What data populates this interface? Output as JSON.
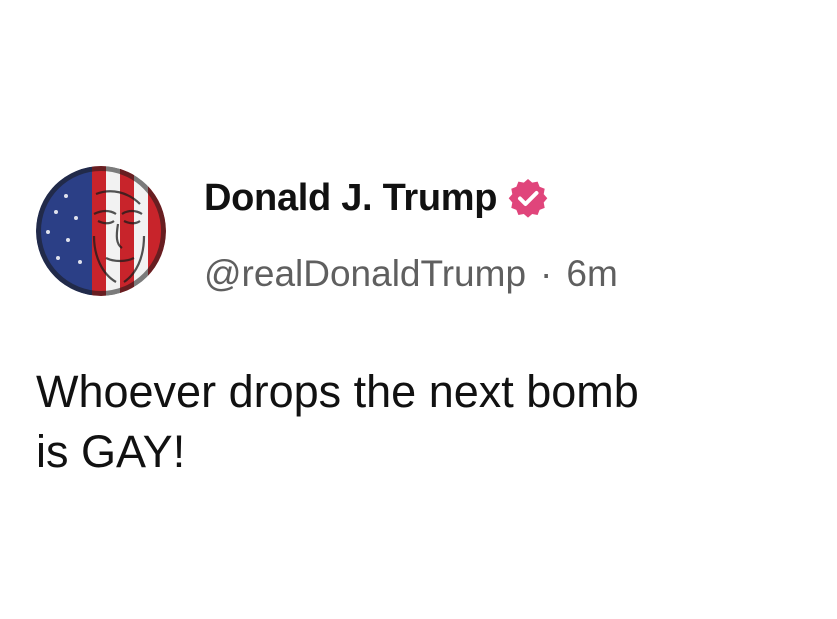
{
  "post": {
    "author": {
      "display_name": "Donald J. Trump",
      "handle": "@realDonaldTrump",
      "verified": true,
      "avatar_icon": "flag-portrait-avatar"
    },
    "separator": "·",
    "timestamp": "6m",
    "body_line_1": "Whoever drops the next bomb",
    "body_line_2": "is GAY!"
  },
  "colors": {
    "badge": "#e0457b",
    "handle_text": "#5f5f5f",
    "body_text": "#111111",
    "flag_red": "#c8242b",
    "flag_blue": "#2b3f86"
  }
}
